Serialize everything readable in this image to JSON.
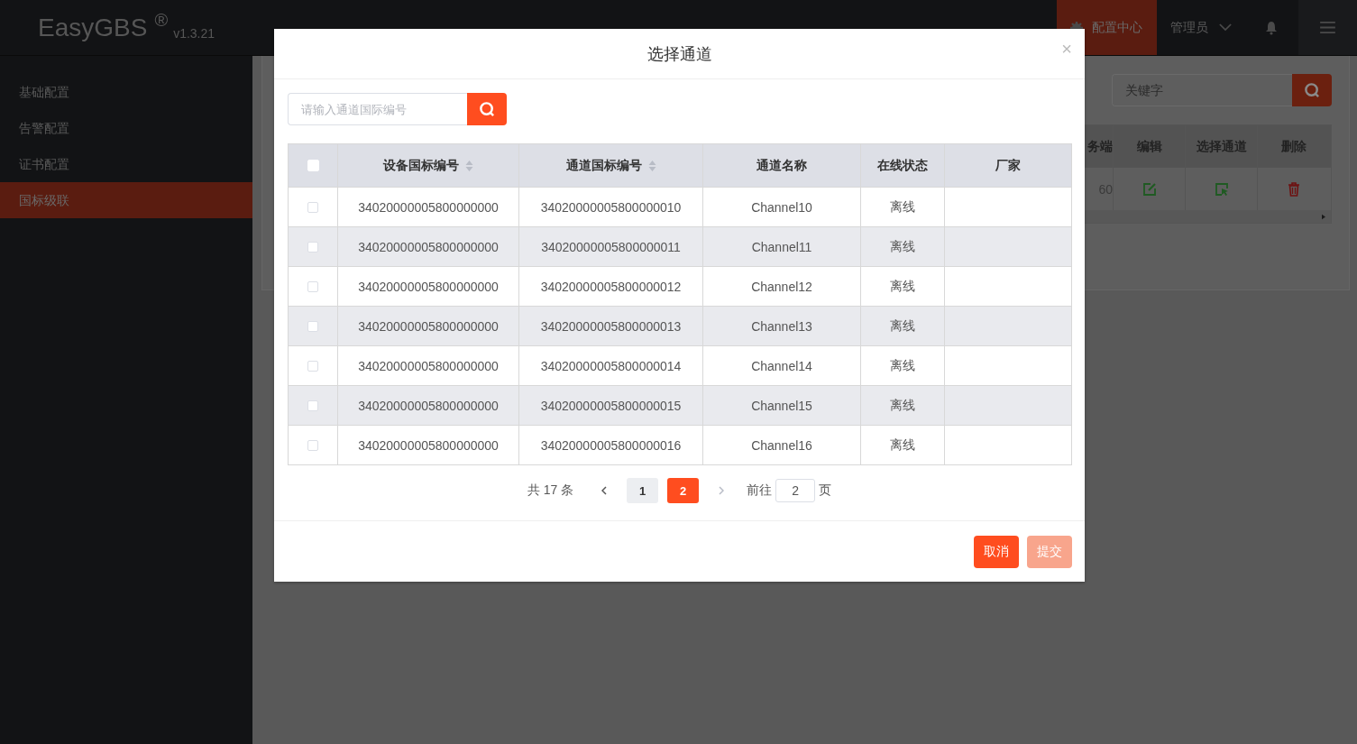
{
  "top_bar": {
    "logo": "EasyGBS",
    "logo_mark": "®",
    "version": "v1.3.21",
    "nav": [
      {
        "label": "配置中心",
        "selected": true
      }
    ],
    "user": "管理员"
  },
  "sidebar": {
    "items": [
      {
        "label": "基础配置",
        "selected": false
      },
      {
        "label": "告警配置",
        "selected": false
      },
      {
        "label": "证书配置",
        "selected": false
      },
      {
        "label": "国标级联",
        "selected": true
      }
    ]
  },
  "background_panel": {
    "search": {
      "placeholder": "关键字"
    },
    "table": {
      "columns": [
        "务端",
        "编辑",
        "选择通道",
        "删除"
      ],
      "rows": [
        {
          "cells": [
            "60"
          ]
        }
      ]
    }
  },
  "dialog": {
    "title": "选择通道",
    "close": "×",
    "search": {
      "placeholder": "请输入通道国际编号"
    },
    "table": {
      "select_all": {
        "checked": false
      },
      "columns": [
        {
          "label": "设备国标编号",
          "sortable": true
        },
        {
          "label": "通道国标编号",
          "sortable": true
        },
        {
          "label": "通道名称",
          "sortable": false
        },
        {
          "label": "在线状态",
          "sortable": false
        },
        {
          "label": "厂家",
          "sortable": false
        }
      ],
      "rows": [
        {
          "checked": false,
          "cells": [
            "34020000005800000000",
            "34020000005800000010",
            "Channel10",
            "离线",
            ""
          ]
        },
        {
          "checked": false,
          "cells": [
            "34020000005800000000",
            "34020000005800000011",
            "Channel11",
            "离线",
            ""
          ]
        },
        {
          "checked": false,
          "cells": [
            "34020000005800000000",
            "34020000005800000012",
            "Channel12",
            "离线",
            ""
          ]
        },
        {
          "checked": false,
          "cells": [
            "34020000005800000000",
            "34020000005800000013",
            "Channel13",
            "离线",
            ""
          ]
        },
        {
          "checked": false,
          "cells": [
            "34020000005800000000",
            "34020000005800000014",
            "Channel14",
            "离线",
            ""
          ]
        },
        {
          "checked": false,
          "cells": [
            "34020000005800000000",
            "34020000005800000015",
            "Channel15",
            "离线",
            ""
          ]
        },
        {
          "checked": false,
          "cells": [
            "34020000005800000000",
            "34020000005800000016",
            "Channel16",
            "离线",
            ""
          ]
        }
      ]
    },
    "pagination": {
      "total": "共 17 条",
      "pages": [
        {
          "label": "1",
          "selected": false
        },
        {
          "label": "2",
          "selected": true
        }
      ],
      "goto_label": "前往",
      "goto_value": "2",
      "goto_suffix": "页"
    },
    "buttons": [
      {
        "label": "取消",
        "kind": "primary"
      },
      {
        "label": "提交",
        "kind": "disabled"
      }
    ]
  }
}
